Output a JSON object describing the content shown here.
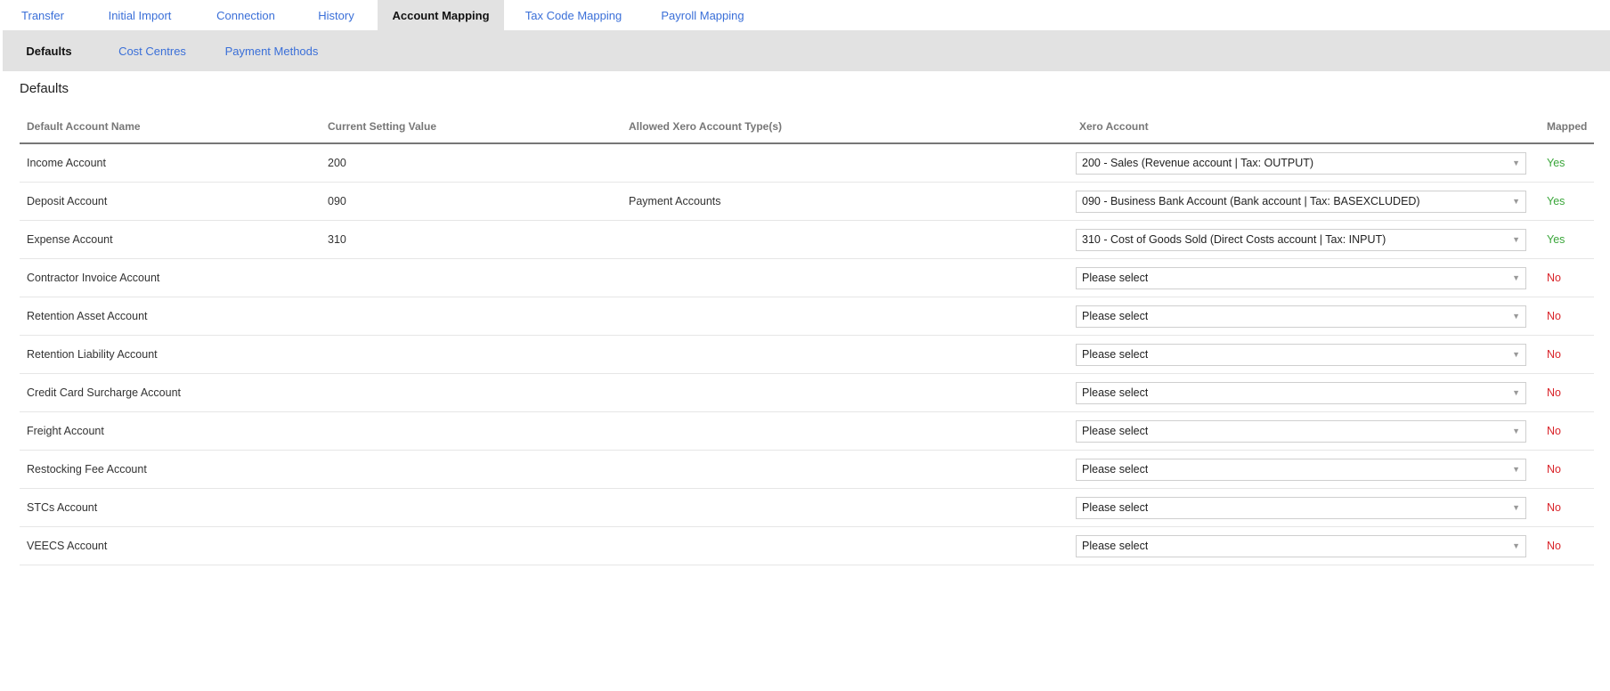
{
  "top_tabs": [
    {
      "label": "Transfer",
      "active": false
    },
    {
      "label": "Initial Import",
      "active": false
    },
    {
      "label": "Connection",
      "active": false
    },
    {
      "label": "History",
      "active": false
    },
    {
      "label": "Account Mapping",
      "active": true
    },
    {
      "label": "Tax Code Mapping",
      "active": false
    },
    {
      "label": "Payroll Mapping",
      "active": false
    }
  ],
  "sub_tabs": [
    {
      "label": "Defaults",
      "active": true
    },
    {
      "label": "Cost Centres",
      "active": false
    },
    {
      "label": "Payment Methods",
      "active": false
    }
  ],
  "section_title": "Defaults",
  "table": {
    "headers": [
      "Default Account Name",
      "Current Setting Value",
      "Allowed Xero Account Type(s)",
      "Xero Account",
      "Mapped"
    ],
    "rows": [
      {
        "name": "Income Account",
        "value": "200",
        "allowed": "",
        "xero": "200 - Sales (Revenue account | Tax: OUTPUT)",
        "mapped": "Yes"
      },
      {
        "name": "Deposit Account",
        "value": "090",
        "allowed": "Payment Accounts",
        "xero": "090 - Business Bank Account (Bank account | Tax: BASEXCLUDED)",
        "mapped": "Yes"
      },
      {
        "name": "Expense Account",
        "value": "310",
        "allowed": "",
        "xero": "310 - Cost of Goods Sold (Direct Costs account | Tax: INPUT)",
        "mapped": "Yes"
      },
      {
        "name": "Contractor Invoice Account",
        "value": "",
        "allowed": "",
        "xero": "Please select",
        "mapped": "No"
      },
      {
        "name": "Retention Asset Account",
        "value": "",
        "allowed": "",
        "xero": "Please select",
        "mapped": "No"
      },
      {
        "name": "Retention Liability Account",
        "value": "",
        "allowed": "",
        "xero": "Please select",
        "mapped": "No"
      },
      {
        "name": "Credit Card Surcharge Account",
        "value": "",
        "allowed": "",
        "xero": "Please select",
        "mapped": "No"
      },
      {
        "name": "Freight Account",
        "value": "",
        "allowed": "",
        "xero": "Please select",
        "mapped": "No"
      },
      {
        "name": "Restocking Fee Account",
        "value": "",
        "allowed": "",
        "xero": "Please select",
        "mapped": "No"
      },
      {
        "name": "STCs Account",
        "value": "",
        "allowed": "",
        "xero": "Please select",
        "mapped": "No"
      },
      {
        "name": "VEECS Account",
        "value": "",
        "allowed": "",
        "xero": "Please select",
        "mapped": "No"
      }
    ]
  },
  "colors": {
    "link": "#3a6fd8",
    "yes": "#3aa63a",
    "no": "#d9242a",
    "tab_bg": "#e2e2e2"
  },
  "icons": {
    "dropdown": "caret-down-icon"
  }
}
